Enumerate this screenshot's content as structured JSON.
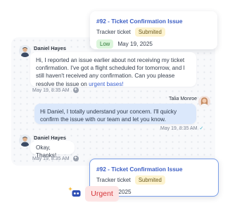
{
  "tickets": {
    "top": {
      "title": "#92 - Ticket Confirmation Issue",
      "type": "Tracker ticket",
      "status": "Submited",
      "priority": "Low",
      "date": "May 19, 2025"
    },
    "bottom": {
      "title": "#92 - Ticket Confirmation Issue",
      "type": "Tracker ticket",
      "status": "Submited",
      "date": "May 19, 2025"
    }
  },
  "messages": [
    {
      "sender": "Daniel Hayes",
      "text_before": "Hi, I reported an issue earlier about not receiving my ticket confirmation. I've got a flight scheduled for tomorrow, and I still haven't received any confirmation. Can you please resolve the issue on ",
      "link": "urgent bases!",
      "time": "May 19, 8:35 AM",
      "reaction_icon": "plus-circle-icon"
    },
    {
      "sender": "Talia Monroe",
      "text": "Hi Daniel, I totally understand your concern. I'll quicky confirm the issue with our team and let you know.",
      "time": "May 19, 8:35 AM",
      "status_icon": "check-icon"
    },
    {
      "sender": "Daniel Hayes",
      "text": "Okay, Thanks!",
      "time": "May 19, 8:35 AM",
      "reaction_icon": "plus-circle-icon"
    }
  ],
  "urgent_label": "Urgent",
  "colors": {
    "ticket_title": "#3d5fc4",
    "agent_bubble": "#dbe8fb",
    "urgent_bg": "#fde5e5",
    "urgent_text": "#d4373a",
    "low_bg": "#dcf5dc",
    "status_bg": "#fdf3cf"
  }
}
